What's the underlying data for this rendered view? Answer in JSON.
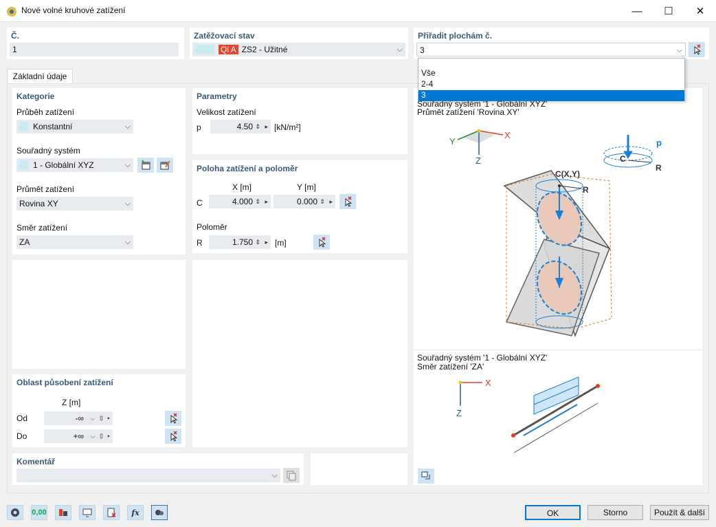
{
  "window": {
    "title": "Nové volné kruhové zatížení",
    "minimize_glyph": "—",
    "maximize_glyph": "☐",
    "close_glyph": "✕"
  },
  "header": {
    "number_label": "Č.",
    "number_value": "1",
    "loadcase_label": "Zatěžovací stav",
    "loadcase_code": "Qi A",
    "loadcase_value": "ZS2 - Užitné",
    "assign_label": "Přiřadit plochám č.",
    "assign_value": "3"
  },
  "assign_options": [
    "Vše",
    "2-4",
    "3"
  ],
  "tabs": [
    "Základní údaje"
  ],
  "category": {
    "title": "Kategorie",
    "distribution_label": "Průběh zatížení",
    "distribution_value": "Konstantní",
    "coord_label": "Souřadný systém",
    "coord_value": "1 - Globální XYZ",
    "projection_label": "Průmět zatížení",
    "projection_value": "Rovina XY",
    "direction_label": "Směr zatížení",
    "direction_value": "ZA"
  },
  "parameters": {
    "title": "Parametry",
    "magnitude_label": "Velikost zatížení",
    "p_label": "p",
    "p_value": "4.50",
    "p_unit": "[kN/m²]"
  },
  "position": {
    "title": "Poloha zatížení a poloměr",
    "x_header": "X [m]",
    "y_header": "Y [m]",
    "c_label": "C",
    "x_value": "4.000",
    "y_value": "0.000",
    "radius_label": "Poloměr",
    "r_label": "R",
    "r_value": "1.750",
    "r_unit": "[m]"
  },
  "area": {
    "title": "Oblast působení zatížení",
    "z_header": "Z [m]",
    "from_label": "Od",
    "from_value": "-∞",
    "to_label": "Do",
    "to_value": "+∞"
  },
  "comment": {
    "title": "Komentář",
    "value": ""
  },
  "preview": {
    "top_line1": "Souřadný systém '1 - Globální XYZ'",
    "top_line2": "Průmět zatížení 'Rovina XY'",
    "bottom_line1": "Souřadný systém '1 - Globální XYZ'",
    "bottom_line2": "Směr zatížení 'ZA'",
    "axis_x": "X",
    "axis_y": "Y",
    "axis_z": "Z",
    "label_p": "p",
    "label_c": "C",
    "label_r": "R",
    "label_cxy": "C(X,Y)"
  },
  "buttons": {
    "ok": "OK",
    "cancel": "Storno",
    "apply_next": "Použít & další",
    "units_icon_text": "0,00",
    "formula_icon_text": "fx"
  },
  "colors": {
    "accent_blue": "#0078d7",
    "header_text": "#3c5a7c",
    "loadcase_red": "#e5452b",
    "field_bg": "#e7eaee",
    "icon_button": "#cfe3f3"
  }
}
